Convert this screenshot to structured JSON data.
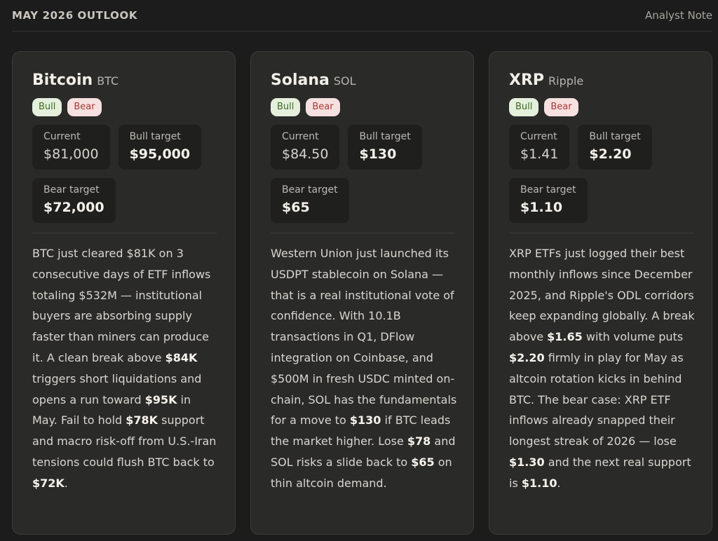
{
  "header": {
    "title": "MAY 2026 OUTLOOK",
    "note": "Analyst Note"
  },
  "colors": {
    "background": "#1c1c1c",
    "card": "#2a2a29",
    "bull_badge_bg": "#e4f0dc",
    "bull_badge_text": "#3e6b25",
    "bear_badge_bg": "#f6e1e0",
    "bear_badge_text": "#a33a36"
  },
  "cards": [
    {
      "name": "Bitcoin",
      "ticker": "BTC",
      "bull_badge": "Bull",
      "bear_badge": "Bear",
      "current_label": "Current",
      "current_value": "$81,000",
      "bull_label": "Bull target",
      "bull_value": "$95,000",
      "bear_label": "Bear target",
      "bear_value": "$72,000",
      "body": [
        {
          "t": "BTC just cleared $81K on 3 consecutive days of ETF inflows totaling $532M — institutional buyers are absorbing supply faster than miners can produce it. A clean break above "
        },
        {
          "t": "$84K",
          "b": true
        },
        {
          "t": " triggers short liquidations and opens a run toward "
        },
        {
          "t": "$95K",
          "b": true
        },
        {
          "t": " in May. Fail to hold "
        },
        {
          "t": "$78K",
          "b": true
        },
        {
          "t": " support and macro risk-off from U.S.-Iran tensions could flush BTC back to "
        },
        {
          "t": "$72K",
          "b": true
        },
        {
          "t": "."
        }
      ]
    },
    {
      "name": "Solana",
      "ticker": "SOL",
      "bull_badge": "Bull",
      "bear_badge": "Bear",
      "current_label": "Current",
      "current_value": "$84.50",
      "bull_label": "Bull target",
      "bull_value": "$130",
      "bear_label": "Bear target",
      "bear_value": "$65",
      "body": [
        {
          "t": "Western Union just launched its USDPT stablecoin on Solana — that is a real institutional vote of confidence. With 10.1B transactions in Q1, DFlow integration on Coinbase, and $500M in fresh USDC minted on-chain, SOL has the fundamentals for a move to "
        },
        {
          "t": "$130",
          "b": true
        },
        {
          "t": " if BTC leads the market higher. Lose "
        },
        {
          "t": "$78",
          "b": true
        },
        {
          "t": " and SOL risks a slide back to "
        },
        {
          "t": "$65",
          "b": true
        },
        {
          "t": " on thin altcoin demand."
        }
      ]
    },
    {
      "name": "XRP",
      "ticker": "Ripple",
      "bull_badge": "Bull",
      "bear_badge": "Bear",
      "current_label": "Current",
      "current_value": "$1.41",
      "bull_label": "Bull target",
      "bull_value": "$2.20",
      "bear_label": "Bear target",
      "bear_value": "$1.10",
      "body": [
        {
          "t": "XRP ETFs just logged their best monthly inflows since December 2025, and Ripple's ODL corridors keep expanding globally. A break above "
        },
        {
          "t": "$1.65",
          "b": true
        },
        {
          "t": " with volume puts "
        },
        {
          "t": "$2.20",
          "b": true
        },
        {
          "t": " firmly in play for May as altcoin rotation kicks in behind BTC. The bear case: XRP ETF inflows already snapped their longest streak of 2026 — lose "
        },
        {
          "t": "$1.30",
          "b": true
        },
        {
          "t": " and the next real support is "
        },
        {
          "t": "$1.10",
          "b": true
        },
        {
          "t": "."
        }
      ]
    }
  ]
}
